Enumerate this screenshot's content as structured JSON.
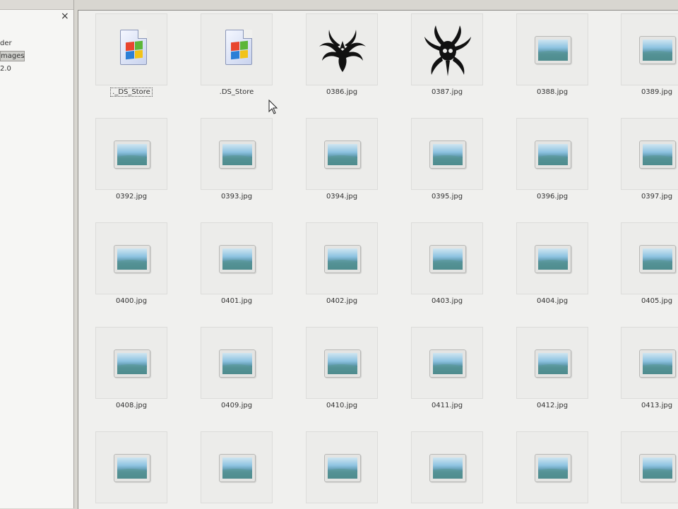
{
  "left_pane": {
    "close_glyph": "×",
    "tree_items": [
      {
        "label": "der",
        "selected": false
      },
      {
        "label": "mages",
        "selected": true
      },
      {
        "label": "2.0",
        "selected": false
      }
    ]
  },
  "files": [
    {
      "name": "._DS_Store",
      "icon": "document-icon",
      "focused": true
    },
    {
      "name": ".DS_Store",
      "icon": "document-icon",
      "focused": false
    },
    {
      "name": "0386.jpg",
      "icon": "tribal-tattoo-icon",
      "focused": false
    },
    {
      "name": "0387.jpg",
      "icon": "tribal-spider-icon",
      "focused": false
    },
    {
      "name": "0388.jpg",
      "icon": "image-icon",
      "focused": false
    },
    {
      "name": "0389.jpg",
      "icon": "image-icon",
      "focused": false
    },
    {
      "name": "0392.jpg",
      "icon": "image-icon",
      "focused": false
    },
    {
      "name": "0393.jpg",
      "icon": "image-icon",
      "focused": false
    },
    {
      "name": "0394.jpg",
      "icon": "image-icon",
      "focused": false
    },
    {
      "name": "0395.jpg",
      "icon": "image-icon",
      "focused": false
    },
    {
      "name": "0396.jpg",
      "icon": "image-icon",
      "focused": false
    },
    {
      "name": "0397.jpg",
      "icon": "image-icon",
      "focused": false
    },
    {
      "name": "0400.jpg",
      "icon": "image-icon",
      "focused": false
    },
    {
      "name": "0401.jpg",
      "icon": "image-icon",
      "focused": false
    },
    {
      "name": "0402.jpg",
      "icon": "image-icon",
      "focused": false
    },
    {
      "name": "0403.jpg",
      "icon": "image-icon",
      "focused": false
    },
    {
      "name": "0404.jpg",
      "icon": "image-icon",
      "focused": false
    },
    {
      "name": "0405.jpg",
      "icon": "image-icon",
      "focused": false
    },
    {
      "name": "0408.jpg",
      "icon": "image-icon",
      "focused": false
    },
    {
      "name": "0409.jpg",
      "icon": "image-icon",
      "focused": false
    },
    {
      "name": "0410.jpg",
      "icon": "image-icon",
      "focused": false
    },
    {
      "name": "0411.jpg",
      "icon": "image-icon",
      "focused": false
    },
    {
      "name": "0412.jpg",
      "icon": "image-icon",
      "focused": false
    },
    {
      "name": "0413.jpg",
      "icon": "image-icon",
      "focused": false
    },
    {
      "name": "",
      "icon": "image-icon",
      "focused": false
    },
    {
      "name": "",
      "icon": "image-icon",
      "focused": false
    },
    {
      "name": "",
      "icon": "image-icon",
      "focused": false
    },
    {
      "name": "",
      "icon": "image-icon",
      "focused": false
    },
    {
      "name": "",
      "icon": "image-icon",
      "focused": false
    },
    {
      "name": "",
      "icon": "image-icon",
      "focused": false
    }
  ],
  "colors": {
    "pane_background": "#f0f0ee",
    "tile_background": "#ececea",
    "selection": "#cfcfcb"
  }
}
